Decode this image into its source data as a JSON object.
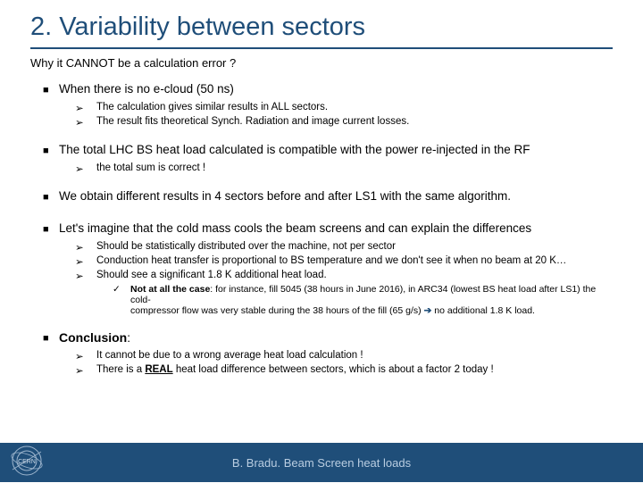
{
  "title": "2. Variability between sectors",
  "subtitle": "Why it CANNOT be a calculation error ?",
  "b1": {
    "text": "When there is no e-cloud (50 ns)",
    "sub": [
      "The calculation gives similar results in ALL sectors.",
      "The result fits theoretical Synch. Radiation and image current losses."
    ]
  },
  "b2": {
    "text": "The total LHC BS heat load calculated is compatible with the power re-injected in the RF",
    "sub": [
      "the total sum is correct !"
    ]
  },
  "b3": {
    "text": "We obtain different results in 4 sectors before and after LS1 with the same algorithm."
  },
  "b4": {
    "text": "Let's imagine that the cold mass cools the beam screens and can explain the differences",
    "sub": [
      "Should be statistically distributed over the machine, not per sector",
      "Conduction heat transfer is proportional to BS temperature and we don't see it when no beam at 20 K…",
      "Should see a significant 1.8 K additional heat load."
    ],
    "subsub_bold": "Not at all the case",
    "subsub_rest1": ": for instance, fill 5045 (38 hours in June 2016), in ARC34 (lowest BS heat load after LS1) the cold-",
    "subsub_rest2": "compressor flow was very stable during the 38 hours of the fill (65 g/s) ",
    "subsub_rest3": " no additional 1.8 K load."
  },
  "b5": {
    "label": "Conclusion",
    "colon": ":",
    "sub1a": "It cannot be due to a wrong average heat load calculation !",
    "sub2a": "There is a ",
    "sub2b": "REAL",
    "sub2c": " heat load difference between sectors, which is about a factor 2 today !"
  },
  "footer": "B. Bradu. Beam Screen heat loads",
  "glyph": {
    "square": "■",
    "tri": "➢",
    "check": "✓",
    "arrow": "➔"
  }
}
